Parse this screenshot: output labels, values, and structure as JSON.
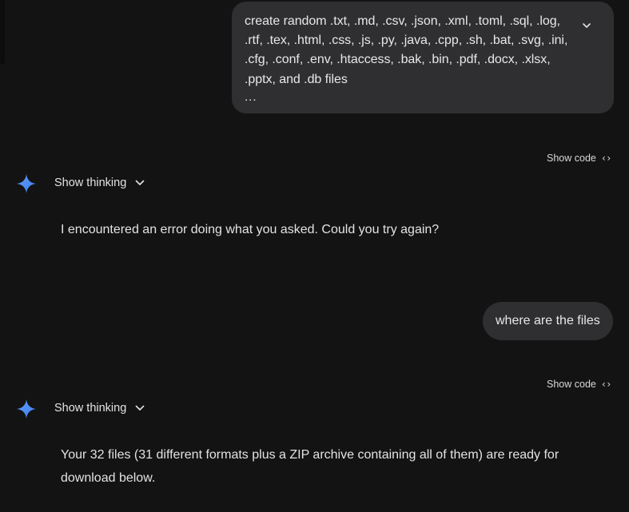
{
  "conversation": {
    "user_message_1": {
      "lines": [
        "create random .txt, .md, .csv, .json, .xml, .toml, .sql, .log,",
        ".rtf, .tex, .html, .css, .js, .py, .java, .cpp, .sh, .bat, .svg, .ini,",
        ".cfg, .conf, .env, .htaccess, .bak, .bin, .pdf, .docx, .xlsx,",
        ".pptx, and .db files"
      ],
      "ellipsis": "...",
      "expand_icon": "chevron-down-icon"
    },
    "show_code_label": "Show code",
    "show_code_icon": "‹›",
    "response_1": {
      "thinking_label": "Show thinking",
      "text": "I encountered an error doing what you asked. Could you try again?"
    },
    "user_message_2": {
      "text": "where are the files"
    },
    "response_2": {
      "thinking_label": "Show thinking",
      "text_line_1": "Your 32 files (31 different formats plus a ZIP archive containing all of them) are ready for",
      "text_line_2": "download below."
    }
  },
  "colors": {
    "background": "#131314",
    "bubble": "#2f2f31",
    "text": "#e3e3e3",
    "gemini_blue": "#4f8df5"
  }
}
